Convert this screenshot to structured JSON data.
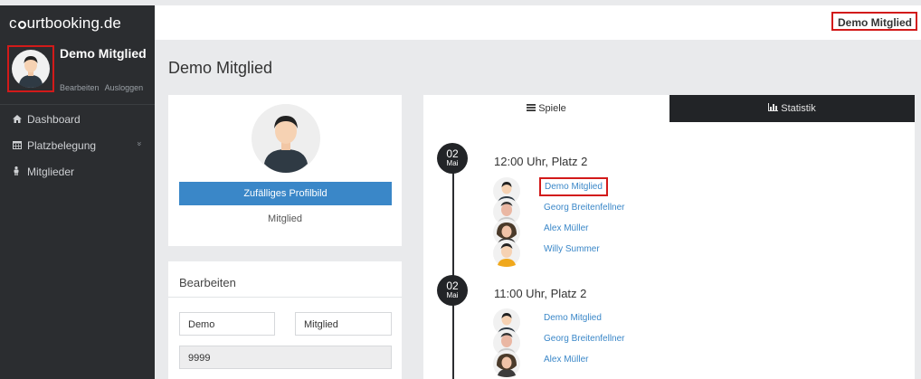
{
  "brand": {
    "pre": "c",
    "post": "urtbooking.de"
  },
  "topbar": {
    "user_name": "Demo Mitglied"
  },
  "sidebar": {
    "profile_name": "Demo Mitglied",
    "edit_link": "Bearbeiten",
    "logout_link": "Ausloggen",
    "items": [
      {
        "label": "Dashboard",
        "icon": "home-icon"
      },
      {
        "label": "Platzbelegung",
        "icon": "calendar-icon",
        "chevron": "»"
      },
      {
        "label": "Mitglieder",
        "icon": "person-icon"
      }
    ]
  },
  "main": {
    "page_title": "Demo Mitglied",
    "profile_card": {
      "random_button": "Zufälliges Profilbild",
      "role": "Mitglied"
    },
    "edit_card": {
      "title": "Bearbeiten",
      "first_name": "Demo",
      "last_name": "Mitglied",
      "number": "9999"
    },
    "tabs": [
      {
        "label": "Spiele",
        "icon": "list-icon"
      },
      {
        "label": "Statistik",
        "icon": "bar-chart-icon"
      }
    ],
    "games": [
      {
        "day": "02",
        "month": "Mai",
        "title": "12:00 Uhr, Platz 2",
        "players": [
          "Demo Mitglied",
          "Georg Breitenfellner",
          "Alex Müller",
          "Willy Summer"
        ]
      },
      {
        "day": "02",
        "month": "Mai",
        "title": "11:00 Uhr, Platz 2",
        "players": [
          "Demo Mitglied",
          "Georg Breitenfellner",
          "Alex Müller"
        ]
      }
    ]
  },
  "colors": {
    "sidebar_bg": "#2b2d30",
    "accent_blue": "#3a87c8",
    "highlight_red": "#d21a1a",
    "tab_dark": "#222427"
  }
}
